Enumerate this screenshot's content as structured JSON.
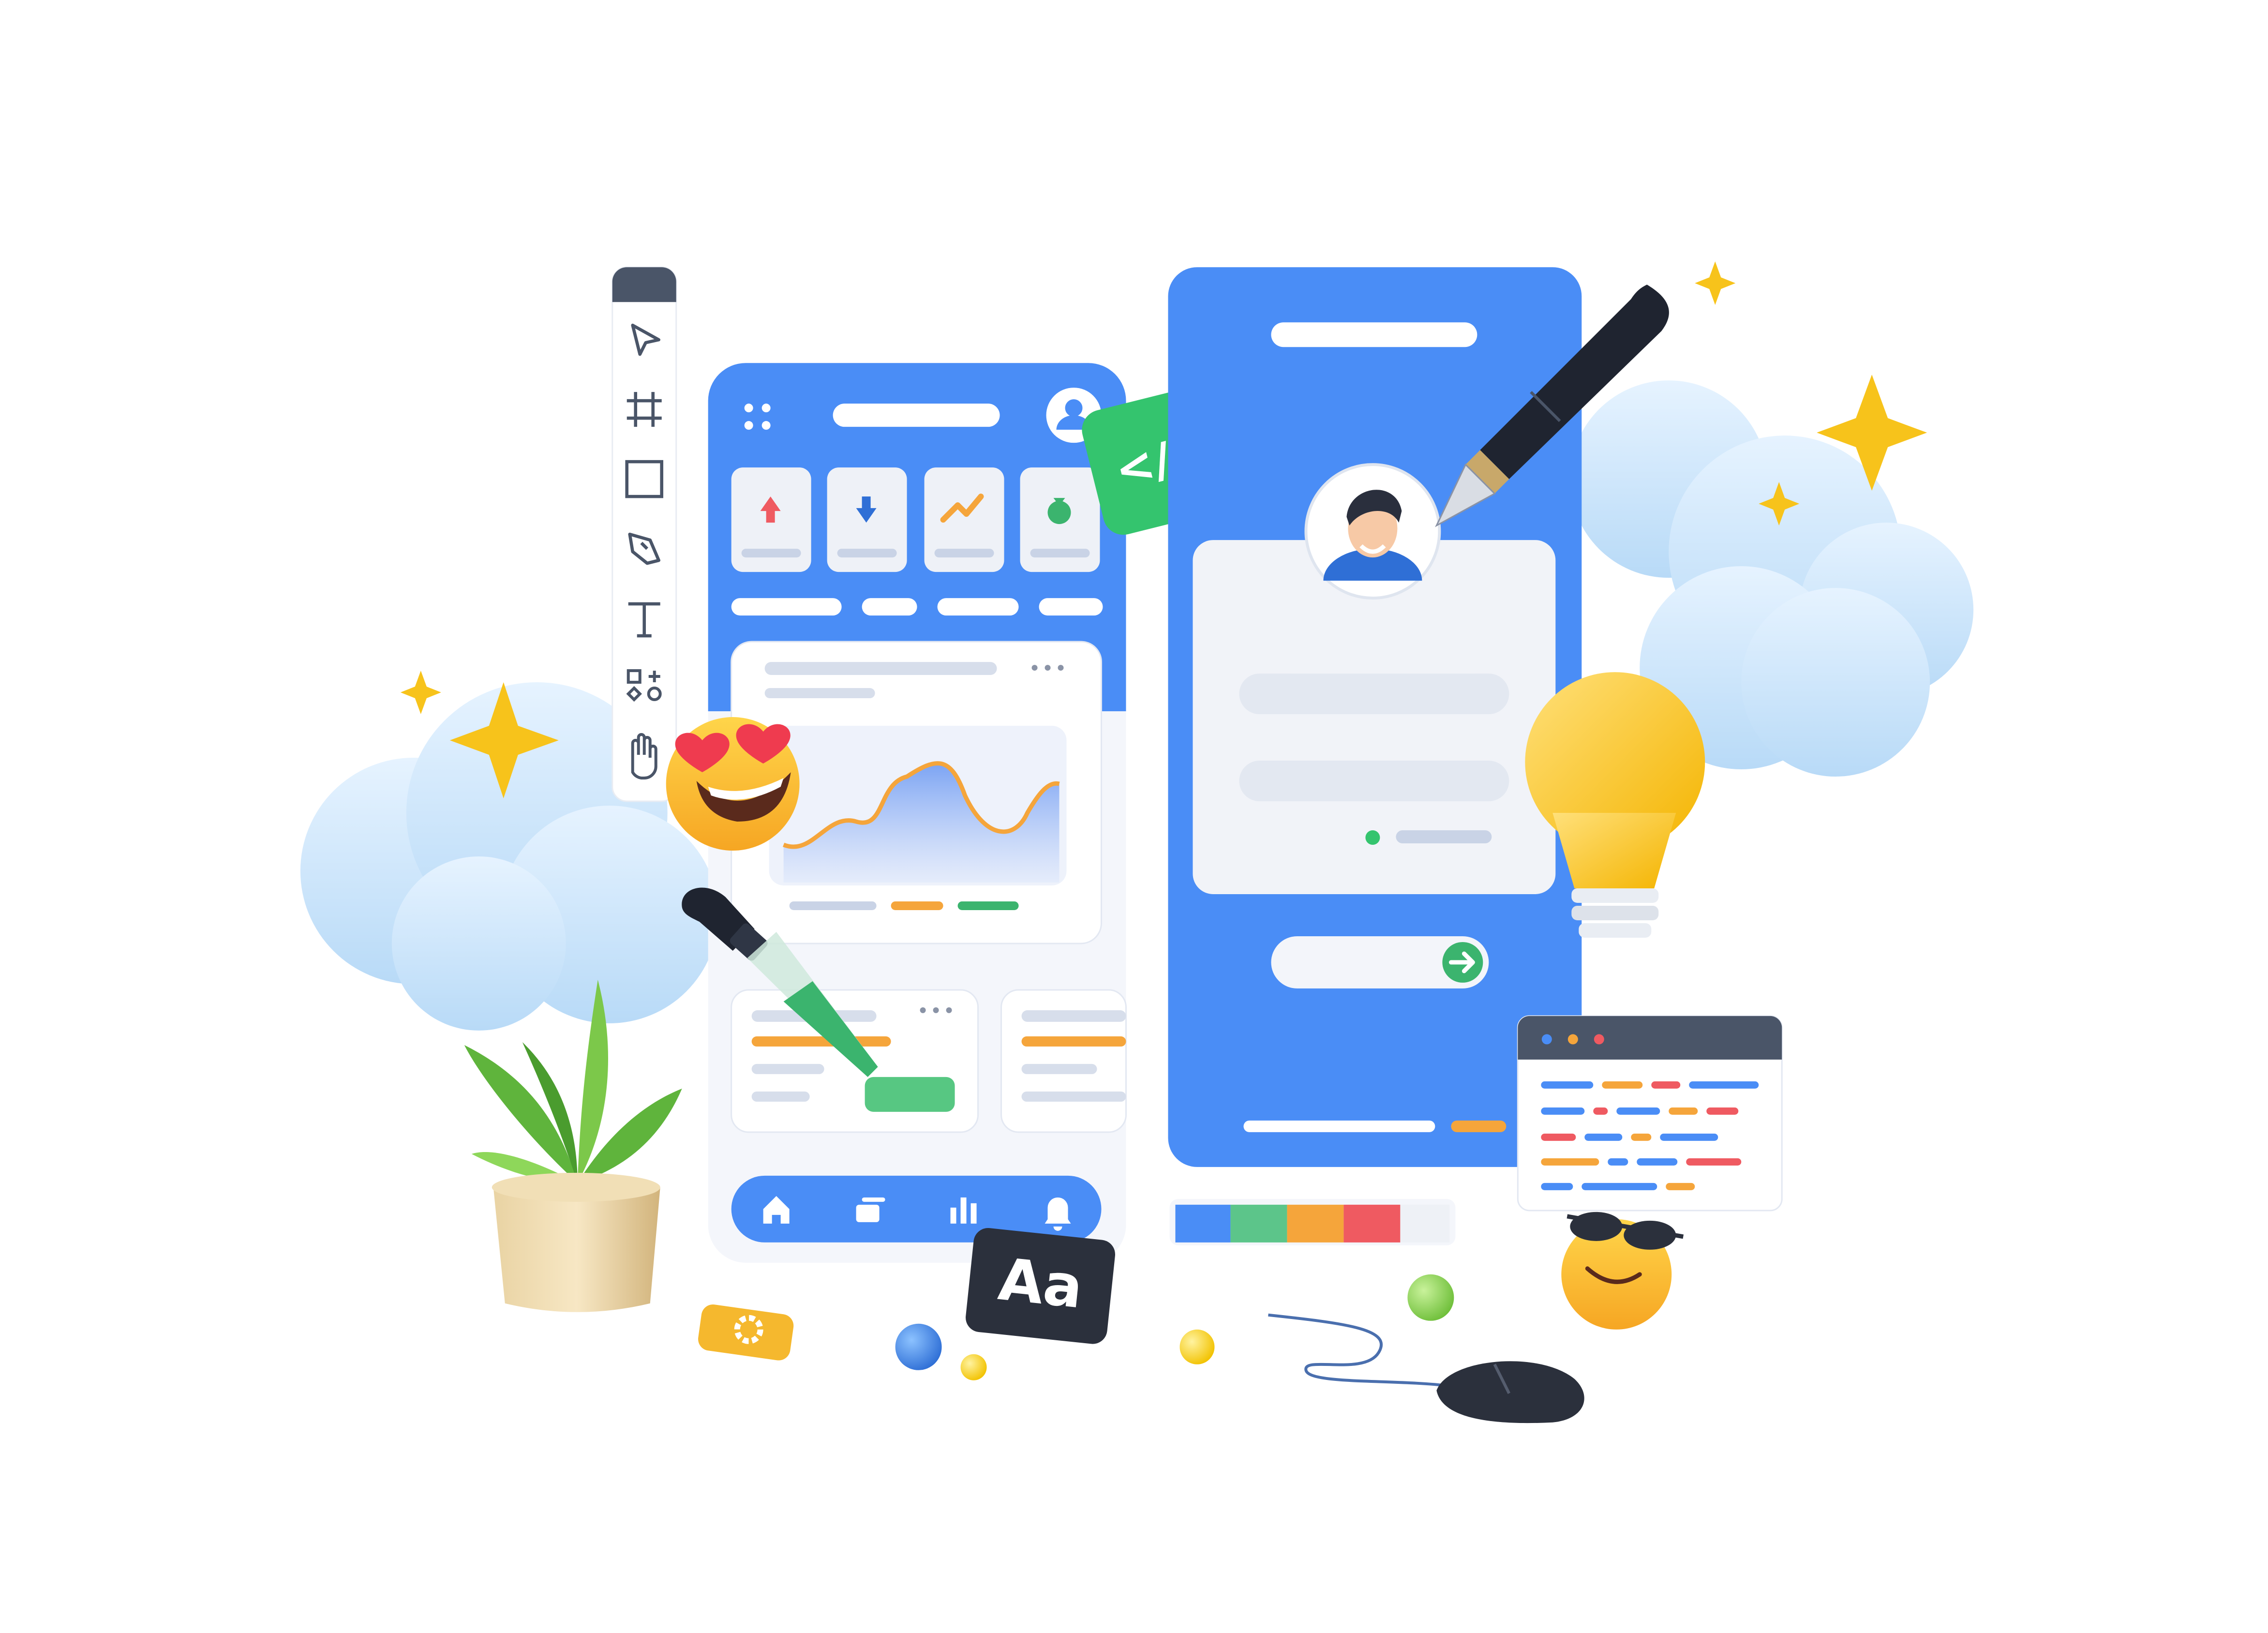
{
  "badges": {
    "code_label": "</>",
    "typography_label": "Aa"
  },
  "colors": {
    "primary_blue": "#4a8df6",
    "card_white": "#f4f6fb",
    "green": "#34c46e",
    "orange": "#f5a53b",
    "red": "#ef5a61",
    "yellow": "#f7c31b"
  },
  "toolbar": {
    "tools": [
      "pointer-icon",
      "frame-icon",
      "rectangle-icon",
      "pen-tool-icon",
      "text-tool-icon",
      "components-icon",
      "hand-icon"
    ]
  },
  "phone_left": {
    "stat_icons": [
      "up-arrow-icon",
      "down-arrow-icon",
      "trend-up-icon",
      "money-bag-icon"
    ],
    "nav_icons": [
      "home-icon",
      "cards-icon",
      "bar-chart-icon",
      "bell-icon"
    ]
  },
  "palette": {
    "swatches": [
      "#4a8df6",
      "#5cc58a",
      "#f5a53b",
      "#ef5a61",
      "#eef1f6"
    ]
  }
}
